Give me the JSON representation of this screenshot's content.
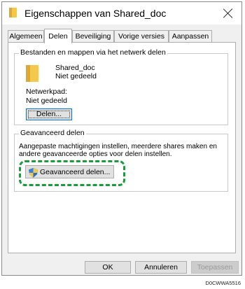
{
  "window": {
    "title": "Eigenschappen van Shared_doc",
    "close_icon": "close-icon"
  },
  "tabs": [
    {
      "label": "Algemeen",
      "active": false
    },
    {
      "label": "Delen",
      "active": true
    },
    {
      "label": "Beveiliging",
      "active": false
    },
    {
      "label": "Vorige versies",
      "active": false
    },
    {
      "label": "Aanpassen",
      "active": false
    }
  ],
  "network_share": {
    "group_title": "Bestanden en mappen via het netwerk delen",
    "folder_icon": "folder-icon",
    "folder_name": "Shared_doc",
    "share_status": "Niet gedeeld",
    "network_path_label": "Netwerkpad:",
    "network_path_value": "Niet gedeeld",
    "share_button": "Delen..."
  },
  "advanced_share": {
    "group_title": "Geavanceerd delen",
    "description_line1": "Aangepaste machtigingen instellen, meerdere shares maken en",
    "description_line2": "andere geavanceerde opties voor delen instellen.",
    "button": "Geavanceerd delen...",
    "button_icon": "shield-icon",
    "highlight_color": "#1a9b3c"
  },
  "footer": {
    "ok": "OK",
    "cancel": "Annuleren",
    "apply": "Toepassen"
  },
  "figure_code": "D0CWWA5516"
}
